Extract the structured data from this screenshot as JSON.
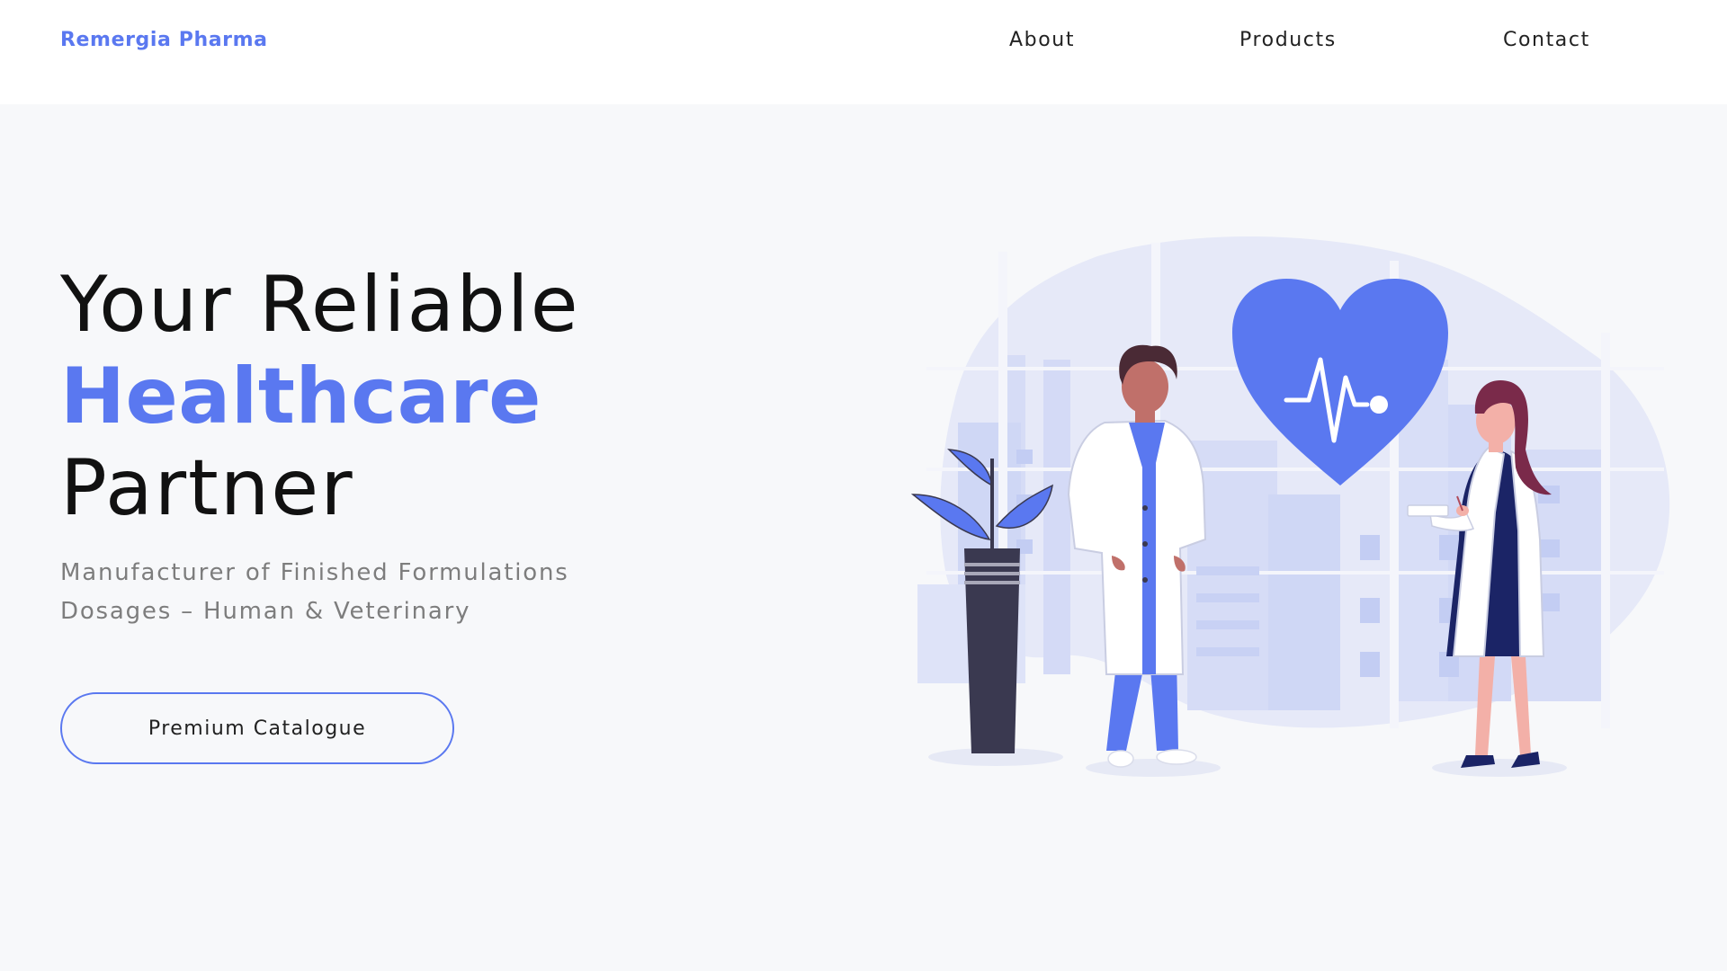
{
  "nav": {
    "brand": "Remergia Pharma",
    "links": [
      {
        "label": "About"
      },
      {
        "label": "Products"
      },
      {
        "label": "Contact"
      }
    ]
  },
  "hero": {
    "title_line1": "Your Reliable",
    "title_line2": "Healthcare",
    "title_line3": "Partner",
    "subtitle_line1": "Manufacturer of Finished Formulations",
    "subtitle_line2": "Dosages – Human & Veterinary",
    "cta_label": "Premium Catalogue"
  },
  "theme": {
    "accent": "#5a78f0",
    "page_background": "#f7f8fa",
    "header_background": "#ffffff",
    "text_dark": "#111111",
    "text_muted": "#7d7d7d"
  },
  "illustration": {
    "icons": [
      "heart-pulse-icon",
      "doctor-figure",
      "nurse-figure",
      "potted-plant"
    ]
  }
}
